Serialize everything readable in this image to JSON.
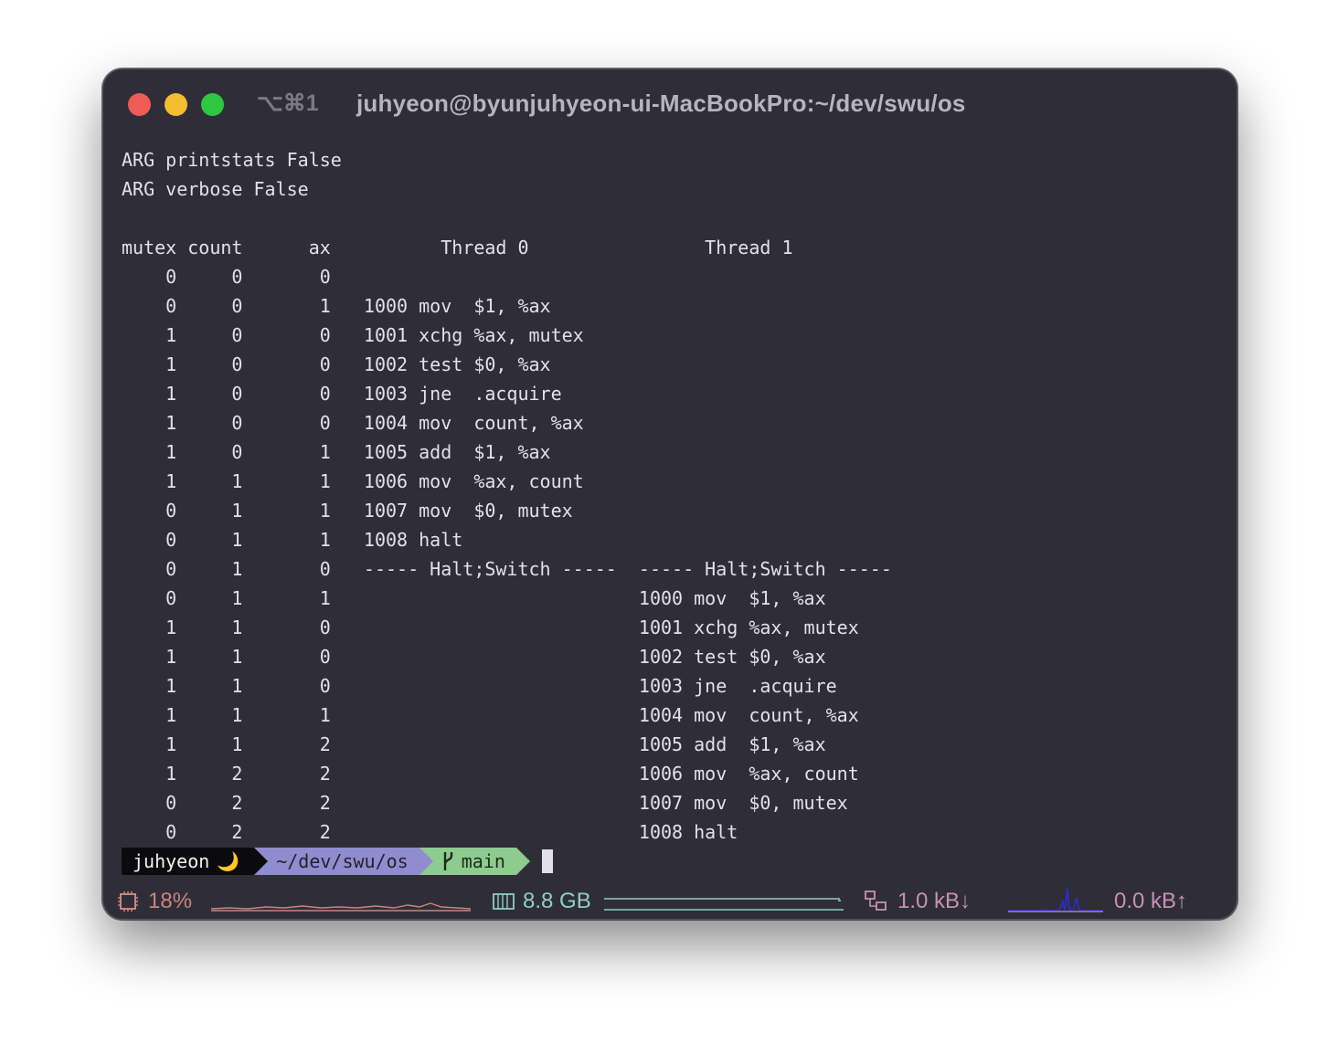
{
  "window": {
    "tab_shortcut": "⌥⌘1",
    "title": "juhyeon@byunjuhyeon-ui-MacBookPro:~/dev/swu/os"
  },
  "terminal": {
    "lines": [
      "ARG printstats False",
      "ARG verbose False",
      "",
      "mutex count      ax          Thread 0                Thread 1",
      "    0     0       0",
      "    0     0       1   1000 mov  $1, %ax",
      "    1     0       0   1001 xchg %ax, mutex",
      "    1     0       0   1002 test $0, %ax",
      "    1     0       0   1003 jne  .acquire",
      "    1     0       0   1004 mov  count, %ax",
      "    1     0       1   1005 add  $1, %ax",
      "    1     1       1   1006 mov  %ax, count",
      "    0     1       1   1007 mov  $0, mutex",
      "    0     1       1   1008 halt",
      "    0     1       0   ----- Halt;Switch -----  ----- Halt;Switch -----",
      "    0     1       1                            1000 mov  $1, %ax",
      "    1     1       0                            1001 xchg %ax, mutex",
      "    1     1       0                            1002 test $0, %ax",
      "    1     1       0                            1003 jne  .acquire",
      "    1     1       1                            1004 mov  count, %ax",
      "    1     1       2                            1005 add  $1, %ax",
      "    1     2       2                            1006 mov  %ax, count",
      "    0     2       2                            1007 mov  $0, mutex",
      "    0     2       2                            1008 halt"
    ]
  },
  "prompt": {
    "user": "juhyeon",
    "user_icon": "moon-icon",
    "moon_glyph": "🌙",
    "path": "~/dev/swu/os",
    "branch_icon": "git-branch-icon",
    "branch": "main"
  },
  "statusbar": {
    "cpu": "18%",
    "memory": "8.8 GB",
    "net_down": "1.0 kB↓",
    "net_up": "0.0 kB↑",
    "colors": {
      "cpu": "#c9847f",
      "memory": "#8fcfbf",
      "network": "#c98fb1",
      "up_graph": "#2b2bd6"
    }
  }
}
